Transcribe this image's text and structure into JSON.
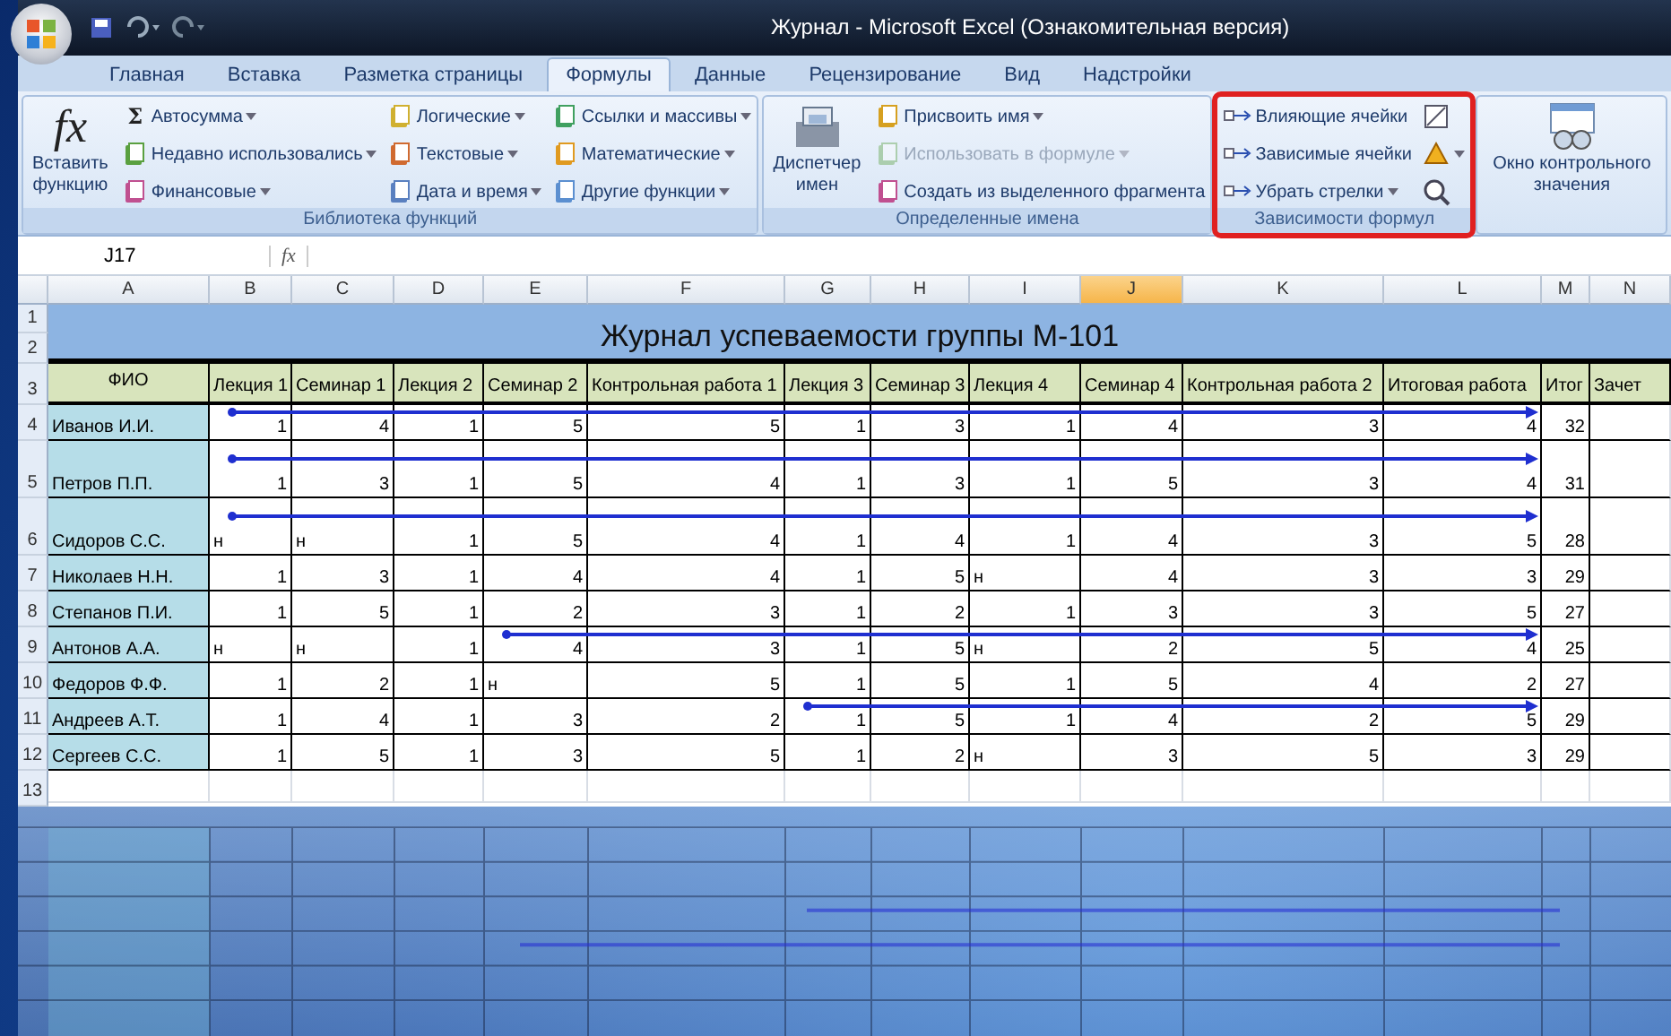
{
  "window": {
    "title": "Журнал - Microsoft Excel (Ознакомительная версия)"
  },
  "tabs": [
    {
      "label": "Главная",
      "selected": false
    },
    {
      "label": "Вставка",
      "selected": false
    },
    {
      "label": "Разметка страницы",
      "selected": false
    },
    {
      "label": "Формулы",
      "selected": true
    },
    {
      "label": "Данные",
      "selected": false
    },
    {
      "label": "Рецензирование",
      "selected": false
    },
    {
      "label": "Вид",
      "selected": false
    },
    {
      "label": "Надстройки",
      "selected": false
    }
  ],
  "ribbon": {
    "groups": [
      {
        "label": "Библиотека функций",
        "highlighted": false,
        "large": {
          "label": "Вставить функцию",
          "glyph": "fx"
        },
        "columns": [
          [
            {
              "label": "Автосумма",
              "glyph": "Σ",
              "dropdown": true,
              "disabled": false
            },
            {
              "label": "Недавно использовались",
              "dropdown": true,
              "disabled": false
            },
            {
              "label": "Финансовые",
              "dropdown": true,
              "disabled": false
            }
          ],
          [
            {
              "label": "Логические",
              "dropdown": true,
              "disabled": false
            },
            {
              "label": "Текстовые",
              "dropdown": true,
              "disabled": false
            },
            {
              "label": "Дата и время",
              "dropdown": true,
              "disabled": false
            }
          ],
          [
            {
              "label": "Ссылки и массивы",
              "dropdown": true,
              "disabled": false
            },
            {
              "label": "Математические",
              "dropdown": true,
              "disabled": false
            },
            {
              "label": "Другие функции",
              "dropdown": true,
              "disabled": false
            }
          ]
        ]
      },
      {
        "label": "Определенные имена",
        "highlighted": false,
        "large": {
          "label": "Диспетчер имен"
        },
        "columns": [
          [
            {
              "label": "Присвоить имя",
              "dropdown": true,
              "disabled": false
            },
            {
              "label": "Использовать в формуле",
              "dropdown": true,
              "disabled": true
            },
            {
              "label": "Создать из выделенного фрагмента",
              "dropdown": false,
              "disabled": false
            }
          ]
        ]
      },
      {
        "label": "Зависимости формул",
        "highlighted": true,
        "columns": [
          [
            {
              "label": "Влияющие ячейки",
              "dropdown": false,
              "disabled": false
            },
            {
              "label": "Зависимые ячейки",
              "dropdown": false,
              "disabled": false
            },
            {
              "label": "Убрать стрелки",
              "dropdown": true,
              "disabled": false
            }
          ],
          [
            {
              "dropdown": false,
              "disabled": false
            },
            {
              "dropdown": true,
              "disabled": false
            },
            {
              "dropdown": false,
              "disabled": false
            }
          ]
        ]
      },
      {
        "large": {
          "label": "Окно контрольного значения"
        },
        "highlighted": false
      }
    ]
  },
  "formula_bar": {
    "name_box": "J17",
    "fx": "fx"
  },
  "sheet": {
    "column_headers": [
      {
        "label": "A",
        "selected": false
      },
      {
        "label": "B",
        "selected": false
      },
      {
        "label": "C",
        "selected": false
      },
      {
        "label": "D",
        "selected": false
      },
      {
        "label": "E",
        "selected": false
      },
      {
        "label": "F",
        "selected": false
      },
      {
        "label": "G",
        "selected": false
      },
      {
        "label": "H",
        "selected": false
      },
      {
        "label": "I",
        "selected": false
      },
      {
        "label": "J",
        "selected": true
      },
      {
        "label": "K",
        "selected": false
      },
      {
        "label": "L",
        "selected": false
      },
      {
        "label": "M",
        "selected": false
      },
      {
        "label": "N",
        "selected": false
      }
    ],
    "title_rows": [
      "1",
      "2"
    ],
    "title": "Журнал успеваемости группы М-101",
    "header_row": "3",
    "columns": [
      "ФИО",
      "Лекция 1",
      "Семинар 1",
      "Лекция 2",
      "Семинар 2",
      "Контрольная работа 1",
      "Лекция 3",
      "Семинар 3",
      "Лекция 4",
      "Семинар 4",
      "Контрольная работа 2",
      "Итоговая работа",
      "Итог",
      "Зачет"
    ],
    "rows": [
      {
        "number": "4",
        "tall": false,
        "arrow_start": [
          false,
          true,
          false,
          false,
          false,
          false,
          false,
          false,
          false,
          false,
          false,
          false,
          false
        ],
        "cells": [
          "Иванов И.И.",
          "1",
          "4",
          "1",
          "5",
          "5",
          "1",
          "3",
          "1",
          "4",
          "3",
          "4",
          "32"
        ]
      },
      {
        "number": "5",
        "tall": true,
        "arrow_start": [
          false,
          true,
          false,
          false,
          false,
          false,
          false,
          false,
          false,
          false,
          false,
          false,
          false
        ],
        "cells": [
          "Петров П.П.",
          "1",
          "3",
          "1",
          "5",
          "4",
          "1",
          "3",
          "1",
          "5",
          "3",
          "4",
          "31"
        ]
      },
      {
        "number": "6",
        "tall": true,
        "arrow_start": [
          false,
          true,
          false,
          false,
          false,
          false,
          false,
          false,
          false,
          false,
          false,
          false,
          false
        ],
        "cells": [
          "Сидоров С.С.",
          "н",
          "н",
          "1",
          "5",
          "4",
          "1",
          "4",
          "1",
          "4",
          "3",
          "5",
          "28"
        ]
      },
      {
        "number": "7",
        "tall": false,
        "cells": [
          "Николаев Н.Н.",
          "1",
          "3",
          "1",
          "4",
          "4",
          "1",
          "5",
          "н",
          "4",
          "3",
          "3",
          "29"
        ]
      },
      {
        "number": "8",
        "tall": false,
        "cells": [
          "Степанов П.И.",
          "1",
          "5",
          "1",
          "2",
          "3",
          "1",
          "2",
          "1",
          "3",
          "3",
          "5",
          "27"
        ]
      },
      {
        "number": "9",
        "tall": false,
        "arrow_start": [
          false,
          false,
          false,
          false,
          true,
          false,
          false,
          false,
          false,
          false,
          false,
          false,
          false
        ],
        "cells": [
          "Антонов А.А.",
          "н",
          "н",
          "1",
          "4",
          "3",
          "1",
          "5",
          "н",
          "2",
          "5",
          "4",
          "25"
        ]
      },
      {
        "number": "10",
        "tall": false,
        "cells": [
          "Федоров Ф.Ф.",
          "1",
          "2",
          "1",
          "н",
          "5",
          "1",
          "5",
          "1",
          "5",
          "4",
          "2",
          "27"
        ]
      },
      {
        "number": "11",
        "tall": false,
        "arrow_start": [
          false,
          false,
          false,
          false,
          false,
          false,
          true,
          false,
          false,
          false,
          false,
          false,
          false
        ],
        "cells": [
          "Андреев А.Т.",
          "1",
          "4",
          "1",
          "3",
          "2",
          "1",
          "5",
          "1",
          "4",
          "2",
          "5",
          "29"
        ]
      },
      {
        "number": "12",
        "tall": false,
        "cells": [
          "Сергеев С.С.",
          "1",
          "5",
          "1",
          "3",
          "5",
          "1",
          "2",
          "н",
          "3",
          "5",
          "3",
          "29"
        ]
      }
    ],
    "empty_rows": [
      "13"
    ]
  }
}
